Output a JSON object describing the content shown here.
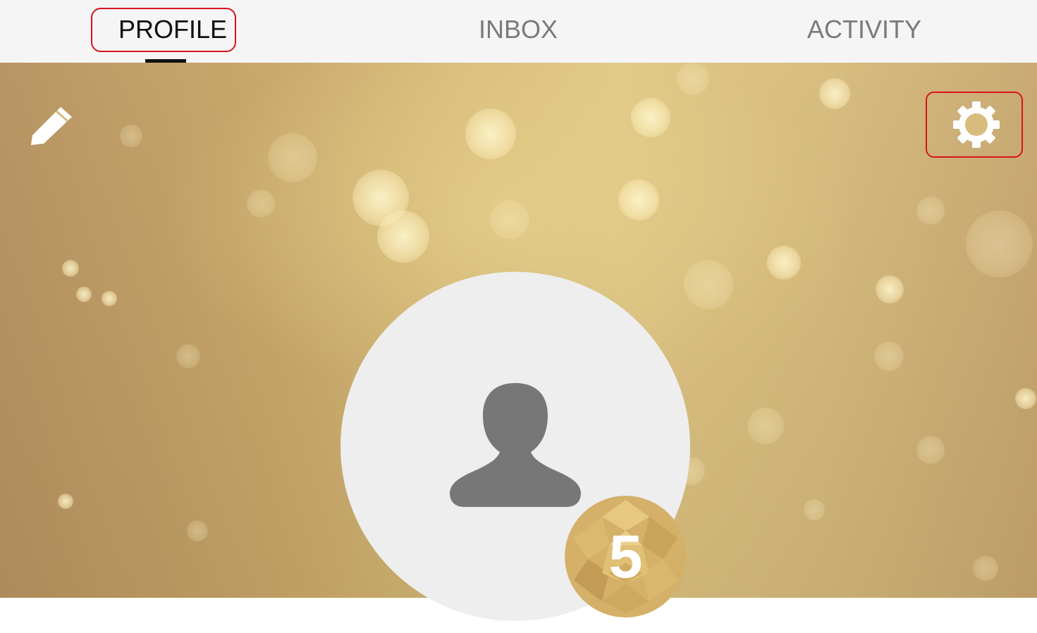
{
  "tabs": [
    {
      "label": "PROFILE",
      "active": true
    },
    {
      "label": "INBOX",
      "active": false
    },
    {
      "label": "ACTIVITY",
      "active": false
    }
  ],
  "cover": {
    "edit_icon": "pencil-icon",
    "settings_icon": "gear-icon"
  },
  "avatar": {
    "icon": "person-icon"
  },
  "badge": {
    "level": "5"
  },
  "colors": {
    "tab_bar_bg": "#f5f5f5",
    "tab_active": "#111111",
    "tab_inactive": "#7a7a7a",
    "highlight": "#d9141e",
    "cover_gold": "#d9bd7c",
    "avatar_bg": "#eeeeee",
    "avatar_icon": "#777777",
    "badge_gold": "#d4b068"
  }
}
